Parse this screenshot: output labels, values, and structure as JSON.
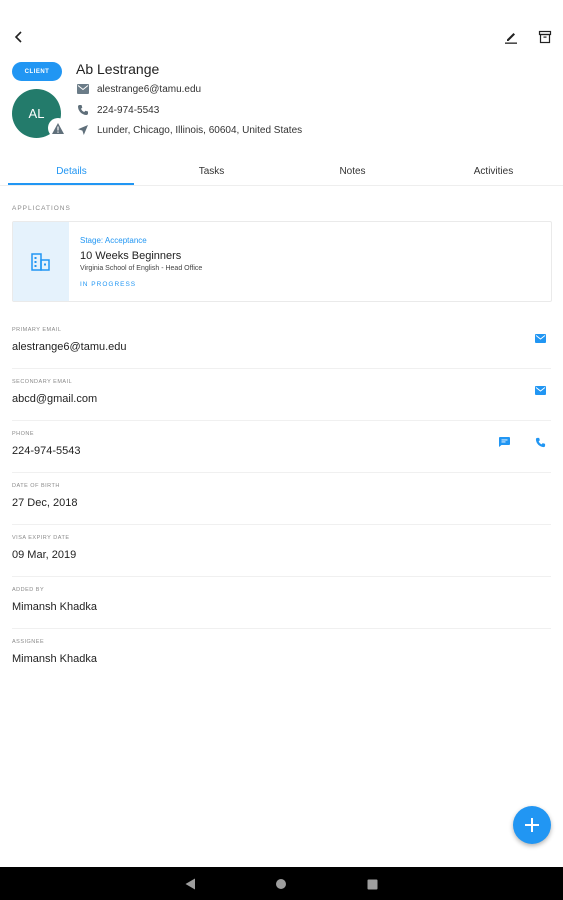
{
  "toolbar": {
    "back_icon": "back-arrow-icon",
    "edit_icon": "edit-icon",
    "archive_icon": "archive-icon"
  },
  "contact": {
    "badge": "CLIENT",
    "name": "Ab Lestrange",
    "initials": "AL",
    "email": "alestrange6@tamu.edu",
    "phone": "224-974-5543",
    "address": "Lunder, Chicago, Illinois, 60604, United States"
  },
  "tabs": [
    {
      "label": "Details",
      "active": true
    },
    {
      "label": "Tasks",
      "active": false
    },
    {
      "label": "Notes",
      "active": false
    },
    {
      "label": "Activities",
      "active": false
    }
  ],
  "applications": {
    "section_label": "APPLICATIONS",
    "card": {
      "stage": "Stage: Acceptance",
      "course": "10 Weeks Beginners",
      "school": "Virginia School of English - Head Office",
      "status": "IN PROGRESS"
    }
  },
  "fields": {
    "primary_email": {
      "label": "PRIMARY EMAIL",
      "value": "alestrange6@tamu.edu"
    },
    "secondary_email": {
      "label": "SECONDARY EMAIL",
      "value": "abcd@gmail.com"
    },
    "phone": {
      "label": "PHONE",
      "value": "224-974-5543"
    },
    "dob": {
      "label": "DATE OF BIRTH",
      "value": "27 Dec, 2018"
    },
    "visa": {
      "label": "VISA EXPIRY DATE",
      "value": "09 Mar, 2019"
    },
    "added_by": {
      "label": "ADDED BY",
      "value": "Mimansh Khadka"
    },
    "assignee": {
      "label": "ASSIGNEE",
      "value": "Mimansh Khadka"
    }
  },
  "colors": {
    "accent": "#2196f3",
    "avatar": "#237b6b",
    "navbar": "#000000"
  }
}
